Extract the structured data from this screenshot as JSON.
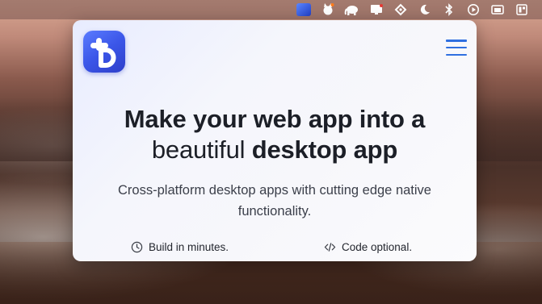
{
  "menubar": {
    "icons": [
      "app-icon",
      "fox-icon",
      "elephant-icon",
      "monitor-icon",
      "tag-icon",
      "moon-icon",
      "bluetooth-icon",
      "play-icon",
      "window-icon",
      "grid-icon"
    ]
  },
  "window": {
    "logo": "tauri-logo",
    "menu_icon": "hamburger-icon",
    "headline": {
      "line1": "Make your web app into a",
      "line2_pre": "beautiful ",
      "line2_strong": "desktop app"
    },
    "subtitle": "Cross-platform desktop apps with cutting edge native functionality.",
    "features": [
      {
        "icon": "clock-icon",
        "label": "Build in minutes."
      },
      {
        "icon": "code-icon",
        "label": "Code optional."
      }
    ]
  },
  "colors": {
    "accent": "#2f6fe0",
    "logo_blue": "#3b56e8",
    "headline": "#1c1f27"
  }
}
